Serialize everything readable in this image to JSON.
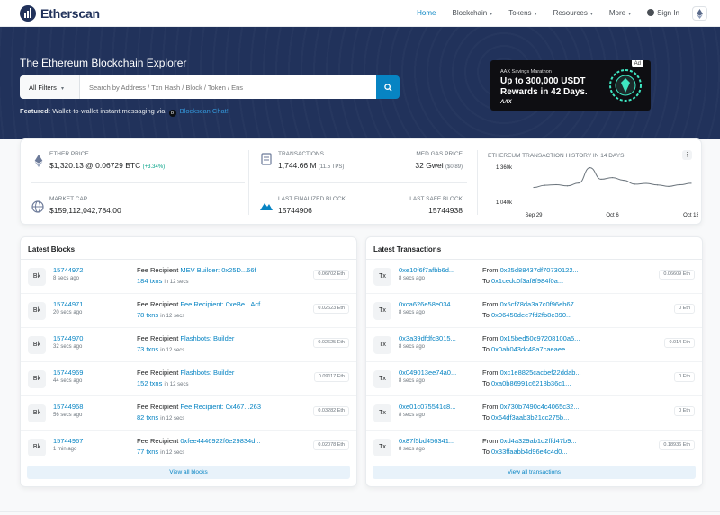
{
  "nav": {
    "brand": "Etherscan",
    "items": [
      {
        "label": "Home",
        "caret": false
      },
      {
        "label": "Blockchain",
        "caret": true
      },
      {
        "label": "Tokens",
        "caret": true
      },
      {
        "label": "Resources",
        "caret": true
      },
      {
        "label": "More",
        "caret": true
      }
    ],
    "signin": "Sign In"
  },
  "hero": {
    "title": "The Ethereum Blockchain Explorer",
    "filter_label": "All Filters",
    "search_placeholder": "Search by Address / Txn Hash / Block / Token / Ens",
    "featured_prefix": "Featured:",
    "featured_text": "Wallet-to-wallet instant messaging via",
    "featured_link": "Blockscan Chat!"
  },
  "ad": {
    "tag": "Ad",
    "small": "AAX Savings Marathon",
    "headline_1": "Up to 300,000 USDT",
    "headline_2": "Rewards in 42 Days.",
    "brand": "AAX"
  },
  "stats": {
    "ether_price_label": "ETHER PRICE",
    "ether_price": "$1,320.13 @ 0.06729 BTC",
    "ether_change": "(+3.34%)",
    "market_cap_label": "MARKET CAP",
    "market_cap": "$159,112,042,784.00",
    "transactions_label": "TRANSACTIONS",
    "transactions": "1,744.66 M",
    "tps": "(11.5 TPS)",
    "gas_label": "MED GAS PRICE",
    "gas": "32 Gwei",
    "gas_usd": "($0.89)",
    "finalized_label": "LAST FINALIZED BLOCK",
    "finalized": "15744906",
    "safe_label": "LAST SAFE BLOCK",
    "safe": "15744938",
    "history_label": "ETHEREUM TRANSACTION HISTORY IN 14 DAYS",
    "menu": "⋮"
  },
  "chart_data": {
    "type": "line",
    "title": "ETHEREUM TRANSACTION HISTORY IN 14 DAYS",
    "x": [
      "Sep 29",
      "Sep 30",
      "Oct 1",
      "Oct 2",
      "Oct 3",
      "Oct 4",
      "Oct 5",
      "Oct 6",
      "Oct 7",
      "Oct 8",
      "Oct 9",
      "Oct 10",
      "Oct 11",
      "Oct 12",
      "Oct 13"
    ],
    "values": [
      1175,
      1195,
      1200,
      1190,
      1215,
      1355,
      1250,
      1265,
      1240,
      1205,
      1212,
      1198,
      1185,
      1200,
      1213
    ],
    "y_ticks": [
      "1 360k",
      "1 040k"
    ],
    "y_tick_values": [
      1360,
      1040
    ],
    "x_ticks": [
      "Sep 29",
      "Oct 6",
      "Oct 13"
    ],
    "ylim": [
      1040,
      1360
    ],
    "grid": false
  },
  "blocks": {
    "title": "Latest Blocks",
    "badge": "Bk",
    "fee_label": "Fee Recipient",
    "in_label": "in 12 secs",
    "items": [
      {
        "number": "15744972",
        "age": "8 secs ago",
        "recipient": "MEV Builder: 0x25D...66f",
        "txns": "184 txns",
        "reward": "0.06702 Eth"
      },
      {
        "number": "15744971",
        "age": "20 secs ago",
        "recipient": "Fee Recipient: 0xeBe...Acf",
        "txns": "78 txns",
        "reward": "0.02623 Eth"
      },
      {
        "number": "15744970",
        "age": "32 secs ago",
        "recipient": "Flashbots: Builder",
        "txns": "73 txns",
        "reward": "0.02625 Eth"
      },
      {
        "number": "15744969",
        "age": "44 secs ago",
        "recipient": "Flashbots: Builder",
        "txns": "152 txns",
        "reward": "0.09117 Eth"
      },
      {
        "number": "15744968",
        "age": "56 secs ago",
        "recipient": "Fee Recipient: 0x467...263",
        "txns": "82 txns",
        "reward": "0.03282 Eth"
      },
      {
        "number": "15744967",
        "age": "1 min ago",
        "recipient": "0xfee4446922f6e29834d...",
        "txns": "77 txns",
        "reward": "0.02078 Eth"
      }
    ],
    "view_all": "View all blocks"
  },
  "transactions": {
    "title": "Latest Transactions",
    "badge": "Tx",
    "from_label": "From",
    "to_label": "To",
    "items": [
      {
        "hash": "0xe10f6f7afbb6d...",
        "age": "8 secs ago",
        "from": "0x25d88437df70730122...",
        "to": "0x1cedc0f3af8f984f0a...",
        "value": "0.06609 Eth"
      },
      {
        "hash": "0xca626e58e034...",
        "age": "8 secs ago",
        "from": "0x5cf78da3a7c0f96eb67...",
        "to": "0x06450dee7fd2fb8e390...",
        "value": "0 Eth"
      },
      {
        "hash": "0x3a39dfdfc3015...",
        "age": "8 secs ago",
        "from": "0x15bed50c97208100a5...",
        "to": "0x0ab043dc48a7caeaee...",
        "value": "0.014 Eth"
      },
      {
        "hash": "0x049013ee74a0...",
        "age": "8 secs ago",
        "from": "0xc1e8825cacbef22ddab...",
        "to": "0xa0b86991c6218b36c1...",
        "value": "0 Eth"
      },
      {
        "hash": "0xe01c075541c8...",
        "age": "8 secs ago",
        "from": "0x730b7490c4c4065c32...",
        "to": "0x64df3aab3b21cc275b...",
        "value": "0 Eth"
      },
      {
        "hash": "0x87f5bd456341...",
        "age": "8 secs ago",
        "from": "0xd4a329ab1d2ffd47b9...",
        "to": "0x33ffaabb4d96e4c4d0...",
        "value": "0.18936 Eth"
      }
    ],
    "view_all": "View all transactions"
  },
  "colors": {
    "brand": "#21325b",
    "link": "#0784c3",
    "positive": "#00a186"
  }
}
